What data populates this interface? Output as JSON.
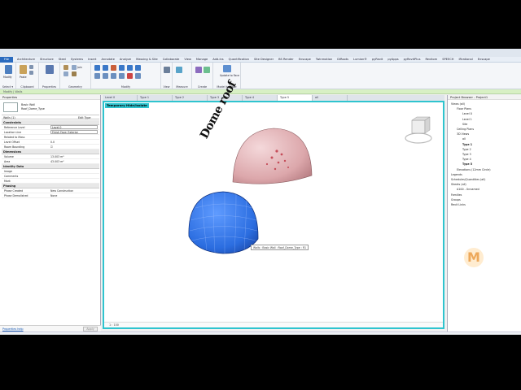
{
  "ribbon": {
    "tabs": [
      "File",
      "Architecture",
      "Structure",
      "Steel",
      "Systems",
      "Insert",
      "Annotate",
      "Analyze",
      "Massing & Site",
      "Collaborate",
      "View",
      "Manage",
      "Add-Ins",
      "Quantification",
      "Site Designer",
      "BS Render",
      "Enscape",
      "Twinmotion",
      "DiRoots",
      "Lumion®",
      "pyRevit",
      "pyApps",
      "pyRevitPlus",
      "Revitom",
      "SPEECH",
      "IRrational",
      "Enscape"
    ],
    "groups": {
      "select": "Select ▾",
      "clipboard": "Clipboard",
      "properties": "Properties",
      "geometry": "Geometry",
      "modify": "Modify",
      "view": "View",
      "measure": "Measure",
      "create": "Create",
      "model_by_face": "Model by Face"
    },
    "buttons": {
      "modify": "Modify",
      "paste": "Paste",
      "cut": "Cut",
      "join": "Join",
      "update_to_face": "Update to Face"
    },
    "context_bar": "Modify | Walls"
  },
  "properties": {
    "title": "Properties",
    "type_line1": "Basic Wall",
    "type_line2": "Roof_Dome_Type",
    "filter": "Walls (1)",
    "edit_type": "Edit Type",
    "sections": [
      {
        "name": "Constraints",
        "rows": [
          {
            "key": "Reference Level",
            "value": "Level 0"
          },
          {
            "key": "Location Line",
            "value": "Finish Face: Exterior"
          },
          {
            "key": "Related to Mass",
            "value": ""
          },
          {
            "key": "Level Offset",
            "value": "0.0"
          },
          {
            "key": "Room Bounding",
            "value": "☑"
          }
        ]
      },
      {
        "name": "Dimensions",
        "rows": [
          {
            "key": "Volume",
            "value": "13.003 m³"
          },
          {
            "key": "Area",
            "value": "43.003 m²"
          }
        ]
      },
      {
        "name": "Identity Data",
        "rows": [
          {
            "key": "Image",
            "value": ""
          },
          {
            "key": "Comments",
            "value": ""
          },
          {
            "key": "Mark",
            "value": ""
          }
        ]
      },
      {
        "name": "Phasing",
        "rows": [
          {
            "key": "Phase Created",
            "value": "New Construction"
          },
          {
            "key": "Phase Demolished",
            "value": "None"
          }
        ]
      }
    ],
    "help_link": "Properties help",
    "apply": "Apply"
  },
  "view_tabs": [
    "Level 0",
    "Type 1",
    "Type 2",
    "Type 3",
    "Type 4",
    "Type 5",
    "all"
  ],
  "active_view_tab": "Type 5",
  "viewport": {
    "temp_label": "Temporary Hide/Isolate",
    "annotation": "Dome roof",
    "tooltip": "Walls : Basic Wall : Roof_Dome_Type : R1",
    "scale": "1 : 100",
    "viewcube_face": "FRONT"
  },
  "browser": {
    "title": "Project Browser - Project1",
    "items": [
      {
        "label": "Views (all)",
        "depth": 0,
        "bold": false
      },
      {
        "label": "Floor Plans",
        "depth": 1,
        "bold": false
      },
      {
        "label": "Level 0",
        "depth": 2,
        "bold": false
      },
      {
        "label": "Level 1",
        "depth": 2,
        "bold": false
      },
      {
        "label": "Site",
        "depth": 2,
        "bold": false
      },
      {
        "label": "Ceiling Plans",
        "depth": 1,
        "bold": false
      },
      {
        "label": "3D Views",
        "depth": 1,
        "bold": false
      },
      {
        "label": "all",
        "depth": 2,
        "bold": false
      },
      {
        "label": "Type 1",
        "depth": 2,
        "bold": true
      },
      {
        "label": "Type 2",
        "depth": 2,
        "bold": false
      },
      {
        "label": "Type 3",
        "depth": 2,
        "bold": false
      },
      {
        "label": "Type 4",
        "depth": 2,
        "bold": false
      },
      {
        "label": "Type 5",
        "depth": 2,
        "bold": true
      },
      {
        "label": "Elevations (12mm Circle)",
        "depth": 1,
        "bold": false
      },
      {
        "label": "Legends",
        "depth": 0,
        "bold": false
      },
      {
        "label": "Schedules/Quantities (all)",
        "depth": 0,
        "bold": false
      },
      {
        "label": "Sheets (all)",
        "depth": 0,
        "bold": false
      },
      {
        "label": "A100 - Unnamed",
        "depth": 1,
        "bold": false
      },
      {
        "label": "Families",
        "depth": 0,
        "bold": false
      },
      {
        "label": "Groups",
        "depth": 0,
        "bold": false
      },
      {
        "label": "Revit Links",
        "depth": 0,
        "bold": false
      }
    ]
  },
  "colors": {
    "accent_cyan": "#2fc4cf",
    "dome_blue": "#2b6de0",
    "dome_pink": "#e4b4b8",
    "context_green": "#d8f0c4"
  },
  "watermark": "M"
}
